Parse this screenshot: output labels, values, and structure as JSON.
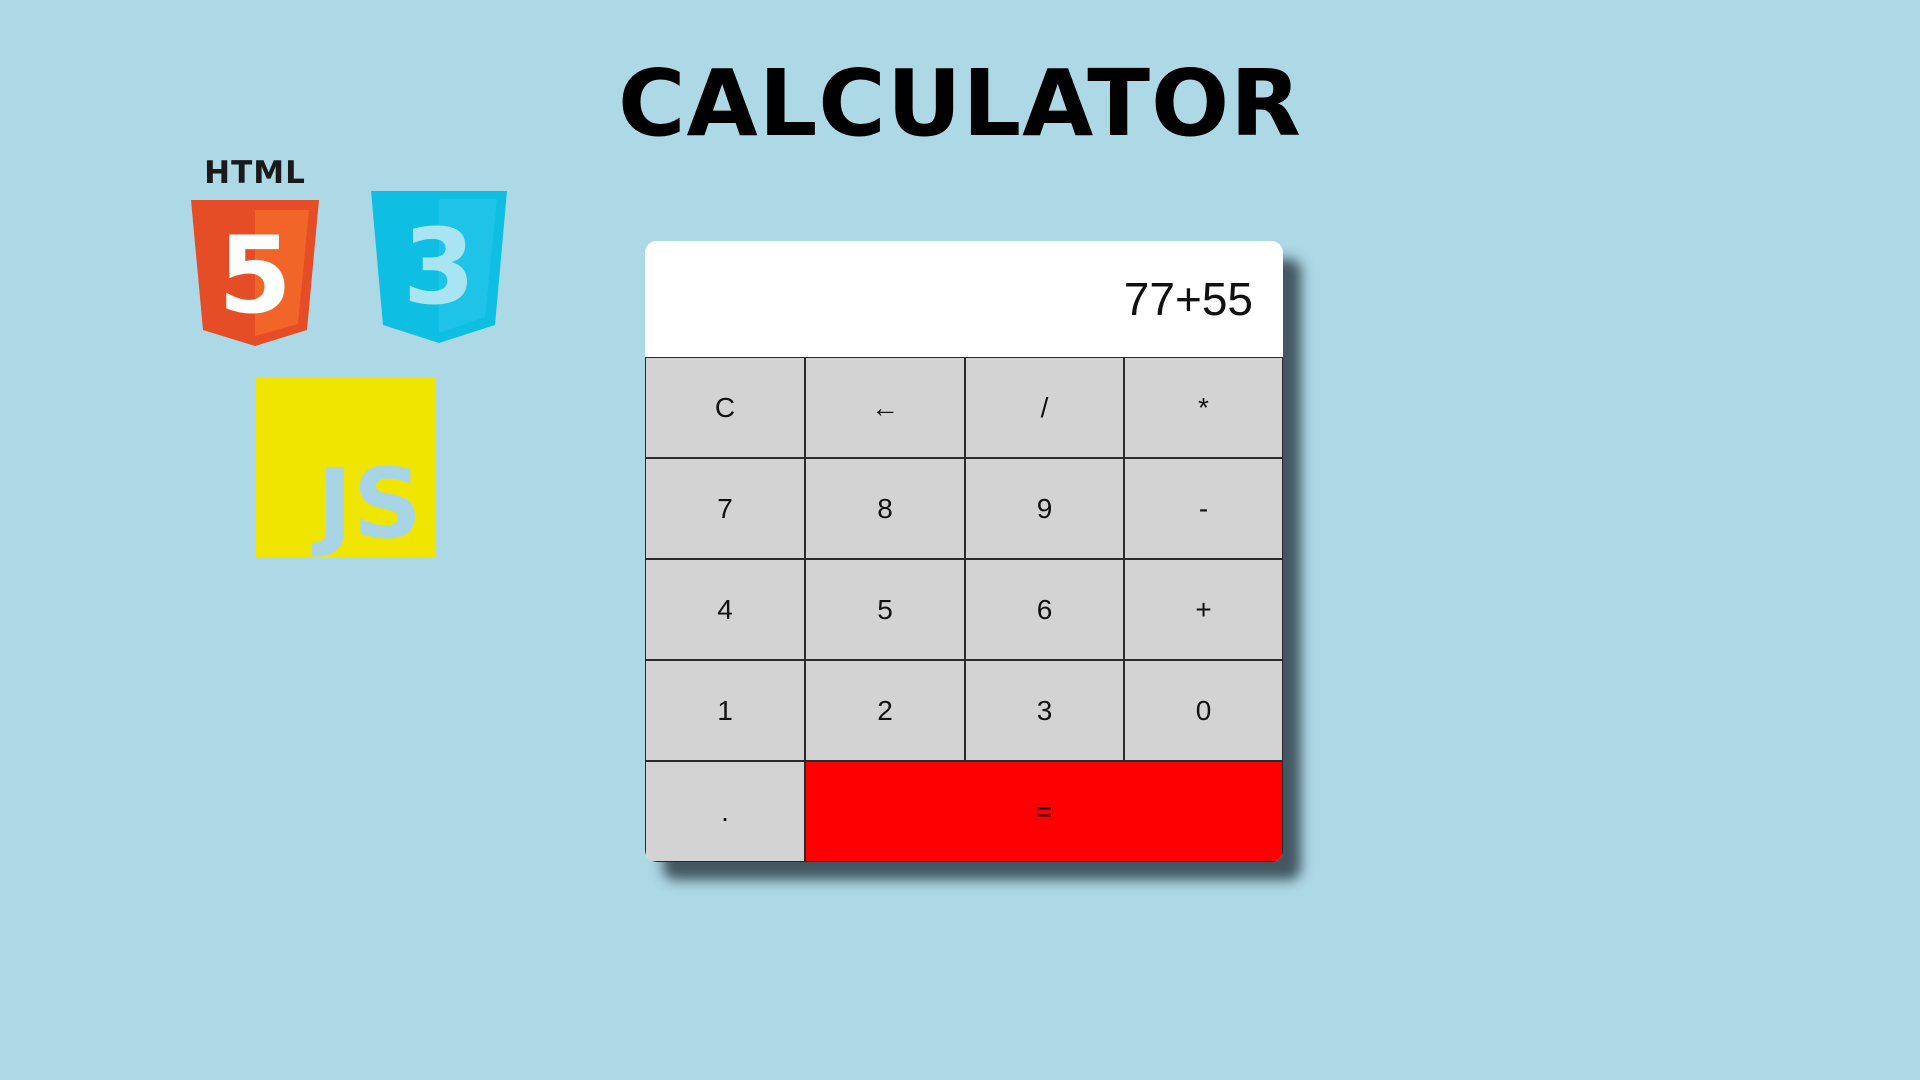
{
  "page": {
    "title": "CALCULATOR"
  },
  "logos": {
    "html": {
      "word": "HTML",
      "badge": "5",
      "color": "#e44d26"
    },
    "css": {
      "badge": "3",
      "color": "#0ebfe3"
    },
    "js": {
      "word": "JS",
      "color": "#f0e500"
    }
  },
  "calculator": {
    "display": "77+55",
    "keys": {
      "clear": "C",
      "backspace": "←",
      "divide": "/",
      "multiply": "*",
      "seven": "7",
      "eight": "8",
      "nine": "9",
      "minus": "-",
      "four": "4",
      "five": "5",
      "six": "6",
      "plus": "+",
      "one": "1",
      "two": "2",
      "three": "3",
      "zero": "0",
      "decimal": ".",
      "equals": "="
    },
    "colors": {
      "key_bg": "#d3d3d3",
      "equals_bg": "#ff0000",
      "display_bg": "#ffffff",
      "page_bg": "#add8e6"
    }
  }
}
